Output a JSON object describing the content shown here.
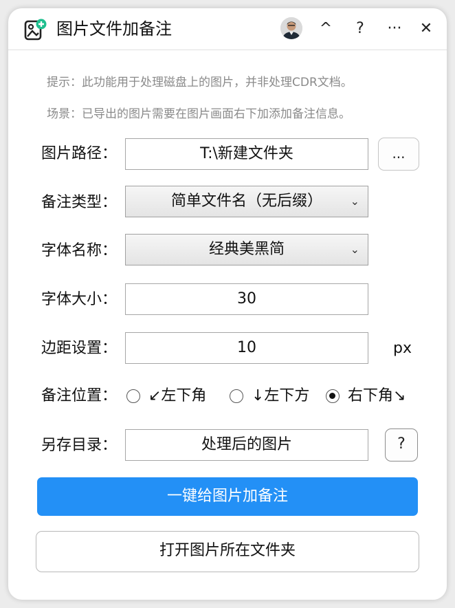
{
  "window": {
    "title": "图片文件加备注",
    "buttons": {
      "collapse": "^",
      "help": "?",
      "more": "···",
      "close": "✕"
    }
  },
  "hints": [
    "提示：此功能用于处理磁盘上的图片，并非处理CDR文档。",
    "场景：已导出的图片需要在图片画面右下加添加备注信息。"
  ],
  "form": {
    "path": {
      "label": "图片路径：",
      "value": "T:\\新建文件夹",
      "browse_label": "..."
    },
    "note_type": {
      "label": "备注类型：",
      "value": "简单文件名（无后缀）"
    },
    "font_name": {
      "label": "字体名称：",
      "value": "经典美黑简"
    },
    "font_size": {
      "label": "字体大小：",
      "value": "30"
    },
    "margin": {
      "label": "边距设置：",
      "value": "10",
      "unit": "px"
    },
    "position": {
      "label": "备注位置：",
      "options": [
        {
          "label": "↙左下角",
          "checked": false
        },
        {
          "label": "↓左下方",
          "checked": false
        },
        {
          "label": "右下角↘",
          "checked": true
        }
      ]
    },
    "save_dir": {
      "label": "另存目录：",
      "value": "处理后的图片",
      "help_label": "?"
    }
  },
  "actions": {
    "primary": "一键给图片加备注",
    "open_folder": "打开图片所在文件夹"
  },
  "colors": {
    "accent": "#2390f6",
    "hint_text": "#8a8a8a",
    "app_icon_green": "#1fbf8f"
  }
}
